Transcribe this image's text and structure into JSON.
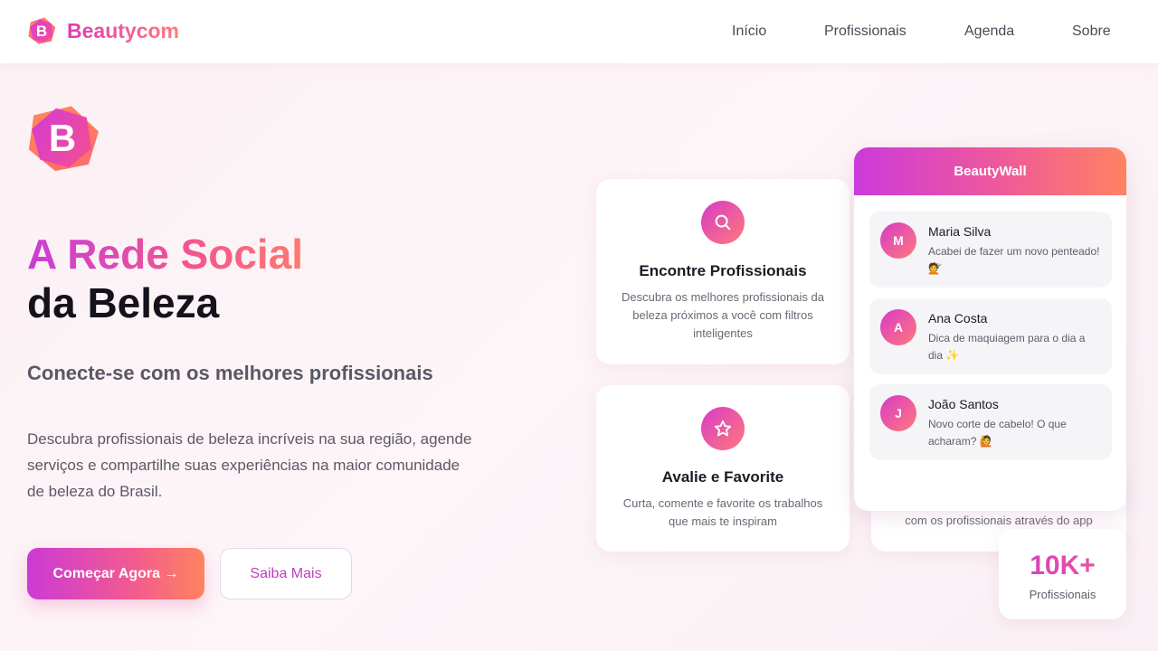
{
  "nav": {
    "brand": "Beautycom",
    "logo_letter": "B",
    "links": [
      "Início",
      "Profissionais",
      "Agenda",
      "Sobre"
    ]
  },
  "hero": {
    "logo_letter": "B",
    "headline_line1": "A Rede Social",
    "headline_line2": "da Beleza",
    "subheadline": "Conecte-se com os melhores profissionais",
    "description": "Descubra profissionais de beleza incríveis na sua região, agende serviços e compartilhe suas experiências na maior comunidade de beleza do Brasil.",
    "primary_button": "Começar Agora →",
    "secondary_button": "Saiba Mais"
  },
  "features": [
    {
      "icon": "search-icon",
      "title": "Encontre Profissionais",
      "description": "Descubra os melhores profissionais da beleza próximos a você com filtros inteligentes"
    },
    {
      "icon": "star-icon",
      "title": "Avalie e Favorite",
      "description": "Curta, comente e favorite os trabalhos que mais te inspiram"
    },
    {
      "partial_text": "com os profissionais através do app"
    }
  ],
  "wall": {
    "title": "BeautyWall",
    "posts": [
      {
        "initial": "M",
        "name": "Maria Silva",
        "text": "Acabei de fazer um novo penteado! 💇"
      },
      {
        "initial": "A",
        "name": "Ana Costa",
        "text": "Dica de maquiagem para o dia a dia ✨"
      },
      {
        "initial": "J",
        "name": "João Santos",
        "text": "Novo corte de cabelo! O que acharam? 🙋"
      }
    ]
  },
  "stat": {
    "value": "10K+",
    "label": "Profissionais"
  },
  "colors": {
    "accent_start": "#cc3ad6",
    "accent_mid": "#f25a8f",
    "accent_end": "#ff845f",
    "background": "#fcf1f5"
  }
}
